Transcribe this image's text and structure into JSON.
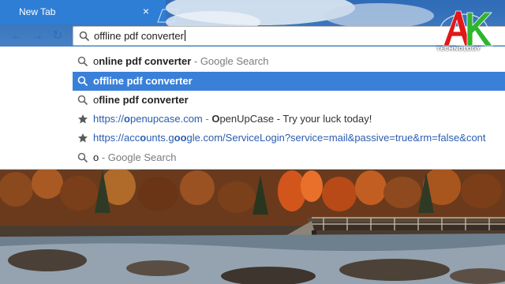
{
  "tab": {
    "title": "New Tab",
    "close_glyph": "×",
    "accent": "#2e7ed6"
  },
  "toolbar": {
    "back_glyph": "←",
    "forward_glyph": "→",
    "reload_glyph": "↻"
  },
  "omnibox": {
    "value": "offline pdf converter"
  },
  "suggestions": [
    {
      "icon": "search-icon",
      "match": "o",
      "rest": "nline pdf converter",
      "suffix": " - Google Search",
      "selected": false
    },
    {
      "icon": "search-icon",
      "text": "offline pdf converter",
      "selected": true
    },
    {
      "icon": "search-icon",
      "match": "o",
      "rest": "fline pdf converter",
      "selected": false
    },
    {
      "icon": "star-icon",
      "url_pre": "https://",
      "url_match": "o",
      "url_post": "penupcase.com",
      "sep": " - ",
      "title_match": "O",
      "title_rest": "penUpCase - Try your luck today!",
      "selected": false
    },
    {
      "icon": "star-icon",
      "url_pre": "https://acc",
      "url_match": "o",
      "url_mid": "unts.g",
      "url_match2": "o",
      "url_mid2": "",
      "url_match3": "o",
      "url_post": "gle.com/ServiceLogin?service=mail&passive=true&rm=false&cont",
      "selected": false
    },
    {
      "icon": "search-icon",
      "match": "o",
      "suffix": " - Google Search",
      "selected": false
    }
  ],
  "logo": {
    "letters": "AK",
    "subtitle": "TECHNOLOGY",
    "colors": {
      "a": "#e01818",
      "k": "#2fb52f"
    }
  },
  "colors": {
    "selected_row": "#3a80d9",
    "url": "#2a5db0",
    "muted": "#7b7b7b"
  }
}
